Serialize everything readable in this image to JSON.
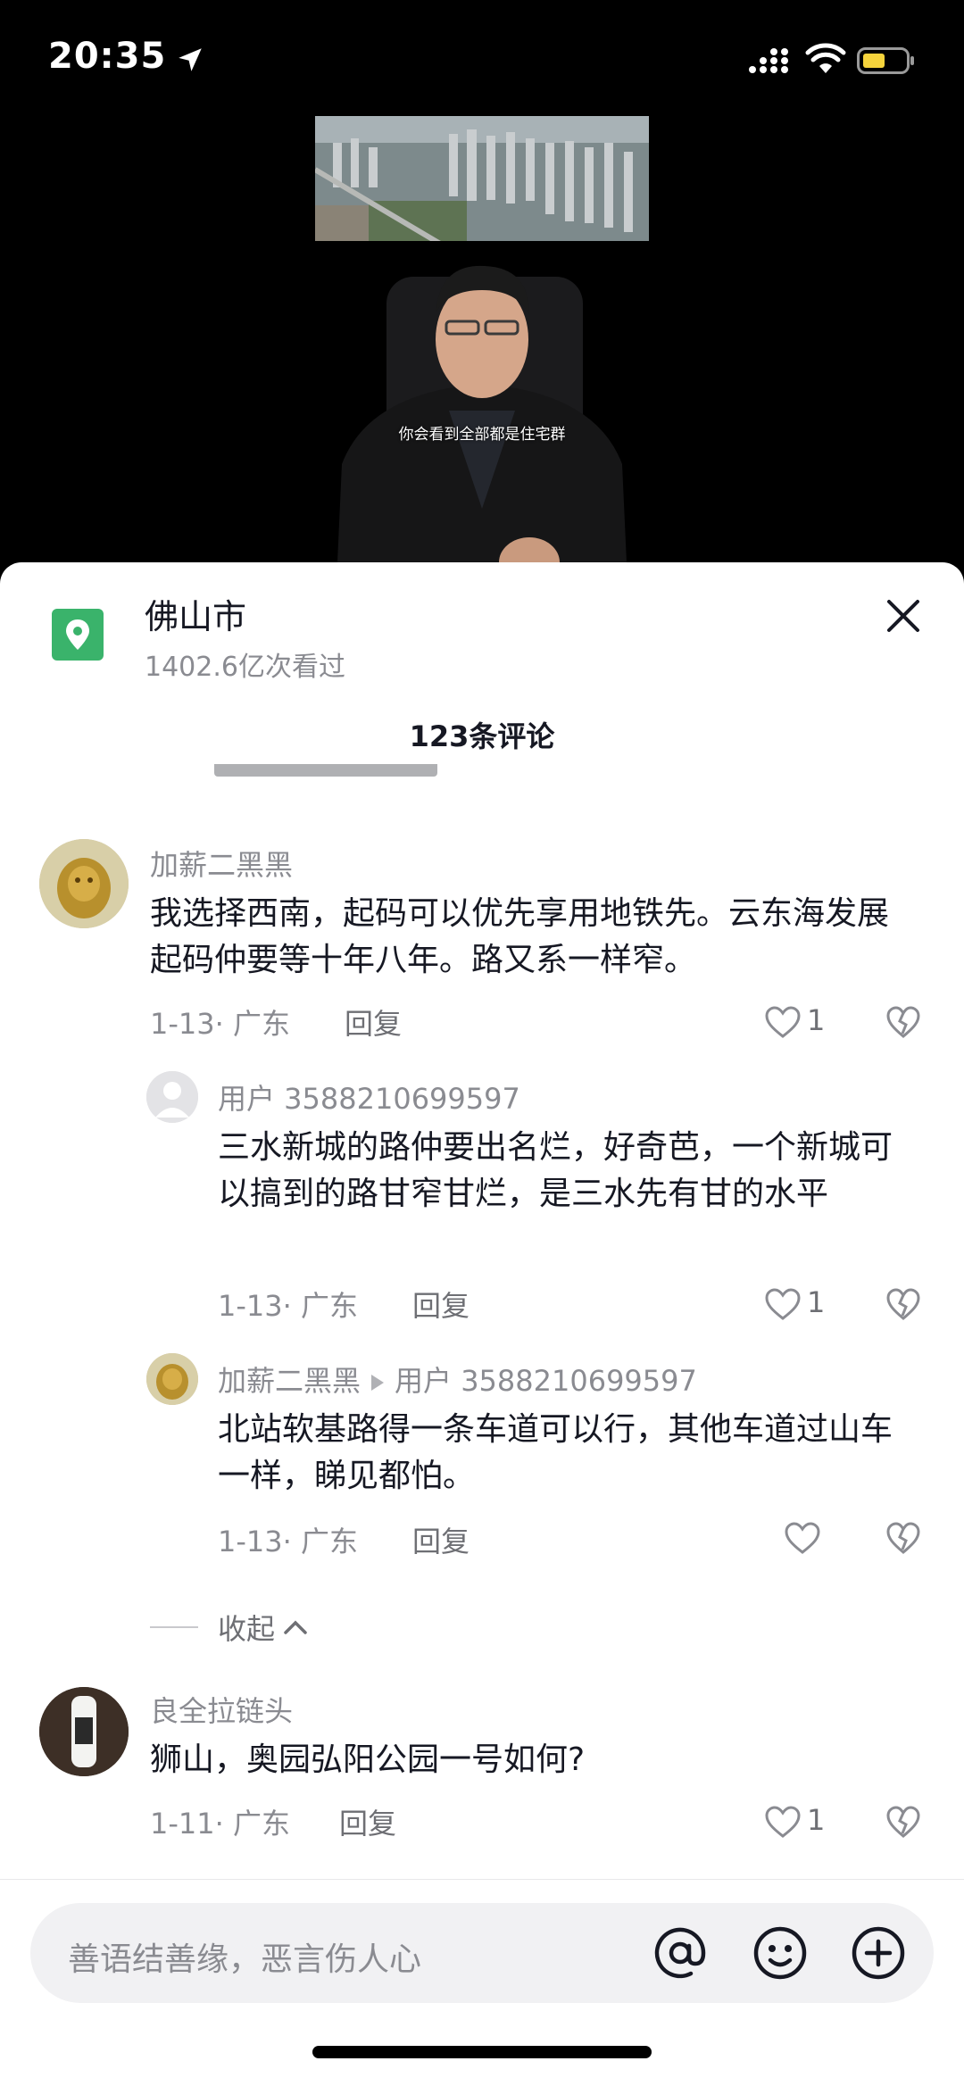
{
  "status_bar": {
    "time": "20:35",
    "battery_color": "#f5d33c"
  },
  "video": {
    "subtitle": "你会看到全部都是住宅群"
  },
  "header": {
    "location_name": "佛山市",
    "location_views": "1402.6亿次看过",
    "location_icon": "map-pin-icon",
    "location_icon_color": "#3ab36b",
    "comment_count": "123条评论"
  },
  "comments": [
    {
      "user": "加薪二黑黑",
      "text": "我选择西南，起码可以优先享用地铁先。云东海发展起码仲要等十年八年。路又系一样窄。",
      "date_loc": "1-13· 广东",
      "reply": "回复",
      "likes": "1"
    },
    {
      "user": "用户 3588210699597",
      "text": "三水新城的路仲要出名烂，好奇芭，一个新城可以搞到的路甘窄甘烂，是三水先有甘的水平",
      "date_loc": "1-13· 广东",
      "reply": "回复",
      "likes": "1"
    },
    {
      "user": "加薪二黑黑",
      "reply_to": "用户 3588210699597",
      "text": "北站软基路得一条车道可以行，其他车道过山车一样，睇见都怕。",
      "date_loc": "1-13· 广东",
      "reply": "回复",
      "likes": ""
    },
    {
      "user": "良全拉链头",
      "text": "狮山，奥园弘阳公园一号如何?",
      "date_loc": "1-11· 广东",
      "reply": "回复",
      "likes": "1"
    }
  ],
  "collapse_label": "收起",
  "input": {
    "placeholder": "善语结善缘，恶言伤人心"
  }
}
